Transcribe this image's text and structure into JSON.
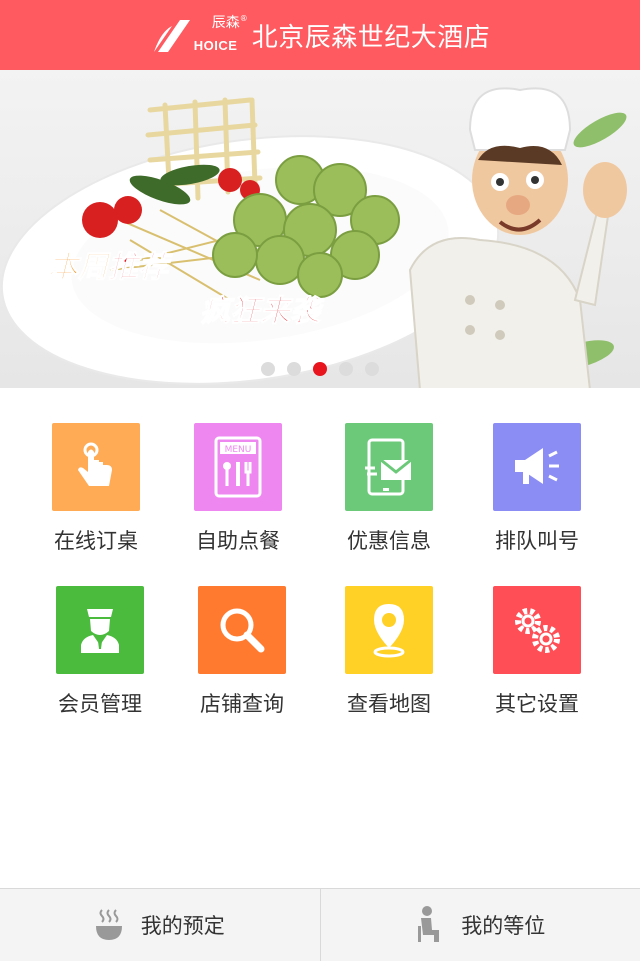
{
  "header": {
    "logo_cn": "辰森",
    "logo_reg": "®",
    "logo_en": "HOICE",
    "title": "北京辰森世纪大酒店",
    "color": "#ff5a5f"
  },
  "banner": {
    "promo_line1_a": "本周",
    "promo_line1_b": "推荐",
    "promo_line2": "疯狂来袭",
    "dots_total": 5,
    "active_dot": 3
  },
  "menu": [
    {
      "label": "在线订桌",
      "icon": "hand-tap-icon",
      "color": "#ffab55"
    },
    {
      "label": "自助点餐",
      "icon": "menu-board-icon",
      "color": "#ee88f0"
    },
    {
      "label": "优惠信息",
      "icon": "phone-mail-icon",
      "color": "#6dc97a"
    },
    {
      "label": "排队叫号",
      "icon": "megaphone-icon",
      "color": "#8c8cf5"
    },
    {
      "label": "会员管理",
      "icon": "member-icon",
      "color": "#4bbb3e"
    },
    {
      "label": "店铺查询",
      "icon": "search-icon",
      "color": "#ff7a2f"
    },
    {
      "label": "查看地图",
      "icon": "map-pin-icon",
      "color": "#ffd026"
    },
    {
      "label": "其它设置",
      "icon": "gears-icon",
      "color": "#ff4e55"
    }
  ],
  "bottom_bar": {
    "reservation_label": "我的预定",
    "queue_label": "我的等位"
  }
}
